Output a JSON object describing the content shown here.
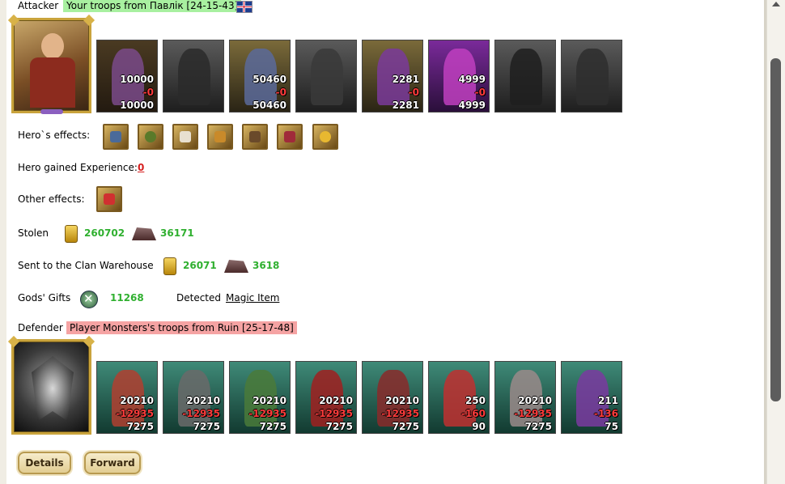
{
  "attacker": {
    "label": "Attacker",
    "troops": "Your troops from Павлік [24-15-43]",
    "flag_icon": "uk-flag-icon",
    "units": [
      {
        "count": "10000",
        "loss": "-0",
        "remaining": "10000"
      },
      {
        "count": "",
        "loss": "",
        "remaining": ""
      },
      {
        "count": "50460",
        "loss": "-0",
        "remaining": "50460"
      },
      {
        "count": "",
        "loss": "",
        "remaining": ""
      },
      {
        "count": "2281",
        "loss": "-0",
        "remaining": "2281"
      },
      {
        "count": "4999",
        "loss": "-0",
        "remaining": "4999"
      },
      {
        "count": "",
        "loss": "",
        "remaining": ""
      },
      {
        "count": "",
        "loss": "",
        "remaining": ""
      }
    ]
  },
  "hero_effects": {
    "label": "Hero`s effects:",
    "icons": [
      "web-shield-icon",
      "ring-icon",
      "scroll-icon",
      "shield-icon",
      "horn-icon",
      "barrel-icon",
      "coins-icon"
    ]
  },
  "experience": {
    "label": "Hero gained Experience:",
    "value": "0"
  },
  "other_effects": {
    "label": "Other effects:",
    "icon": "sword-icon"
  },
  "stolen": {
    "label": "Stolen",
    "gold": "260702",
    "ore": "36171"
  },
  "clan": {
    "label": "Sent to the Clan Warehouse",
    "gold": "26071",
    "ore": "3618"
  },
  "gifts": {
    "label": "Gods' Gifts",
    "value": "11268",
    "detected_label": "Detected",
    "detected_item": "Magic Item"
  },
  "defender": {
    "label": "Defender",
    "troops": "Player Monsters's troops from Ruin [25-17-48]",
    "units": [
      {
        "count": "20210",
        "loss": "-12935",
        "remaining": "7275"
      },
      {
        "count": "20210",
        "loss": "-12935",
        "remaining": "7275"
      },
      {
        "count": "20210",
        "loss": "-12935",
        "remaining": "7275"
      },
      {
        "count": "20210",
        "loss": "-12935",
        "remaining": "7275"
      },
      {
        "count": "20210",
        "loss": "-12935",
        "remaining": "7275"
      },
      {
        "count": "250",
        "loss": "-160",
        "remaining": "90"
      },
      {
        "count": "20210",
        "loss": "-12935",
        "remaining": "7275"
      },
      {
        "count": "211",
        "loss": "-136",
        "remaining": "75"
      }
    ]
  },
  "buttons": {
    "details": "Details",
    "forward": "Forward"
  },
  "colors": {
    "gain": "#30b030",
    "loss": "#ff3b3b",
    "attacker_badge": "#a8f0a0",
    "defender_badge": "#f5a3a3"
  }
}
